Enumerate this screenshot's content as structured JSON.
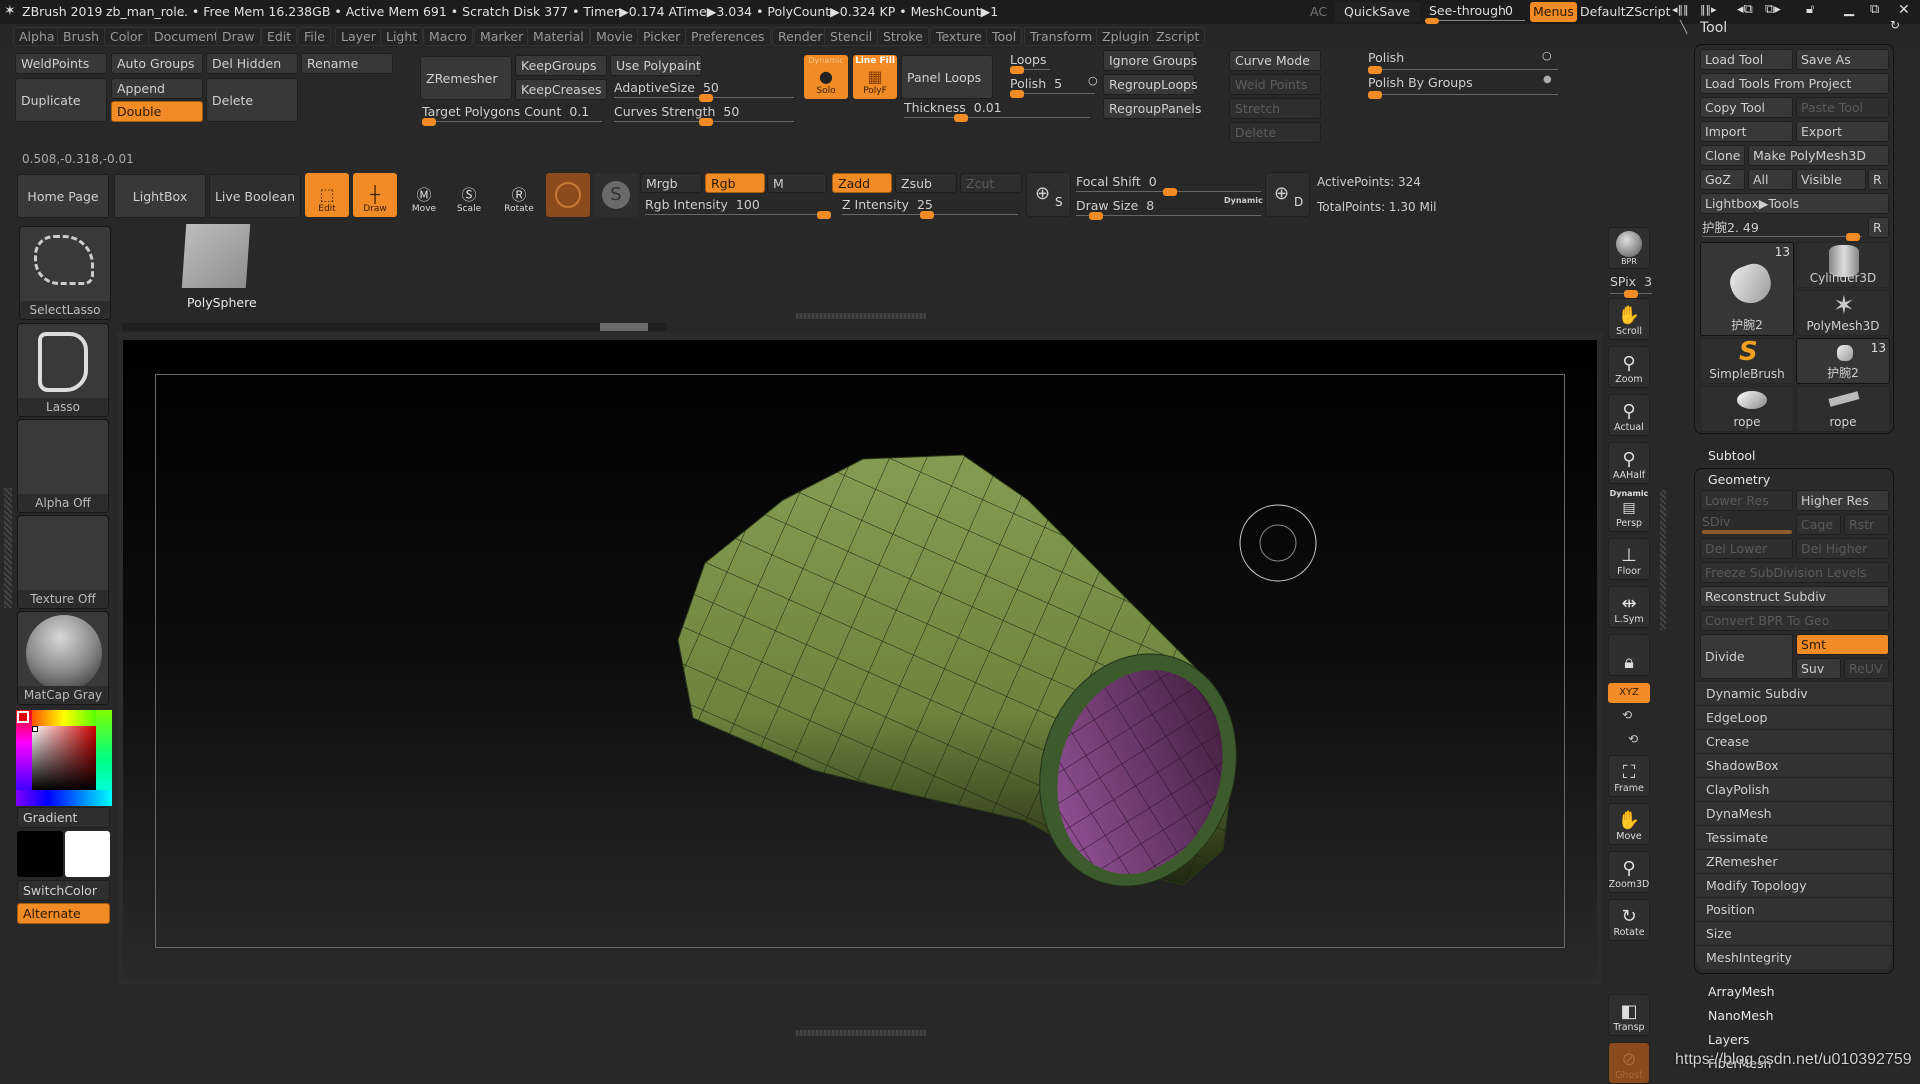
{
  "titlebar": {
    "app_title": "ZBrush 2019",
    "project": "zb_man_role",
    "status": ".. • Free Mem 16.238GB • Active Mem 691 • Scratch Disk 377 •  Timer▶0.174 ATime▶3.034 • PolyCount▶0.324 KP  • MeshCount▶1",
    "ac": "AC",
    "quicksave": "QuickSave",
    "see_through_label": "See-through",
    "see_through_value": "0",
    "see_through_fraction": 0.0,
    "menus": "Menus",
    "default_zscript": "DefaultZScript"
  },
  "menubar": [
    "Alpha",
    "Brush",
    "Color",
    "Document",
    "Draw",
    "Edit",
    "File",
    "Layer",
    "Light",
    "Macro",
    "Marker",
    "Material",
    "Movie",
    "Picker",
    "Preferences",
    "Render",
    "Stencil",
    "Stroke",
    "Texture",
    "Tool",
    "Transform",
    "Zplugin",
    "Zscript"
  ],
  "top_shelf": {
    "subtool_buttons": {
      "weldpoints": "WeldPoints",
      "auto_groups": "Auto Groups",
      "del_hidden": "Del Hidden",
      "rename": "Rename",
      "duplicate": "Duplicate",
      "append": "Append",
      "double": "Double",
      "delete": "Delete"
    },
    "zremesher": {
      "button": "ZRemesher",
      "keep_groups": "KeepGroups",
      "keep_creases": "KeepCreases",
      "use_polypaint": "Use Polypaint",
      "adaptive_size_label": "AdaptiveSize",
      "adaptive_size_value": "50",
      "target_polys_label": "Target Polygons Count",
      "target_polys_value": "0.1",
      "curves_strength_label": "Curves Strength",
      "curves_strength_value": "50"
    },
    "panel_loops": {
      "dynamic_label": "Dynamic",
      "solo_label": "Solo",
      "line_fill_label": "Line Fill",
      "polyf_label": "PolyF",
      "panel_loops_button": "Panel Loops",
      "thickness_label": "Thickness",
      "thickness_value": "0.01",
      "loops_label": "Loops",
      "polish_label": "Polish",
      "polish_value": "5",
      "ignore_groups": "Ignore Groups",
      "regroup_loops": "RegroupLoops",
      "regroup_panels": "RegroupPanels"
    },
    "curve": {
      "curve_mode": "Curve Mode",
      "weld_points": "Weld Points",
      "stretch": "Stretch",
      "delete": "Delete"
    },
    "polish": {
      "polish": "Polish",
      "polish_by_groups": "Polish By Groups"
    },
    "coordinates": "0.508,-0.318,-0.01"
  },
  "toolbar2": {
    "home_page": "Home Page",
    "lightbox": "LightBox",
    "live_boolean": "Live Boolean",
    "edit": "Edit",
    "draw": "Draw",
    "move": "Move",
    "scale": "Scale",
    "rotate": "Rotate",
    "mrgb": "Mrgb",
    "rgb": "Rgb",
    "m": "M",
    "zadd": "Zadd",
    "zsub": "Zsub",
    "zcut": "Zcut",
    "rgb_intensity_label": "Rgb Intensity",
    "rgb_intensity_value": "100",
    "z_intensity_label": "Z Intensity",
    "z_intensity_value": "25",
    "focal_shift_label": "Focal Shift",
    "focal_shift_value": "0",
    "draw_size_label": "Draw Size",
    "draw_size_value": "8",
    "dynamic_label": "Dynamic",
    "active_points": "ActivePoints: 324",
    "total_points": "TotalPoints: 1.30 Mil",
    "s_label": "S",
    "d_label": "D"
  },
  "left_shelf": {
    "select_lasso": "SelectLasso",
    "lasso": "Lasso",
    "alpha_off": "Alpha Off",
    "texture_off": "Texture Off",
    "matcap_gray": "MatCap Gray",
    "gradient": "Gradient",
    "switch_color": "SwitchColor",
    "alternate": "Alternate",
    "main_color": "#e00000",
    "secondary_color": "#ffffff"
  },
  "canvas": {
    "polysphere_label": "PolySphere",
    "mesh_outer_color": "#7a9448",
    "mesh_inner_color": "#8a4a88",
    "mesh_rim_color": "#3d5a2c"
  },
  "right_shelf": {
    "bpr": "BPR",
    "spix_label": "SPix",
    "spix_value": "3",
    "scroll": "Scroll",
    "zoom": "Zoom",
    "actual": "Actual",
    "aahalf": "AAHalf",
    "dynamic": "Dynamic",
    "persp": "Persp",
    "floor": "Floor",
    "lsym": "L.Sym",
    "xyz": "XYZ",
    "frame": "Frame",
    "move": "Move",
    "zoom3d": "Zoom3D",
    "rotate": "Rotate",
    "transp": "Transp",
    "ghost": "Ghost"
  },
  "tool_palette": {
    "title": "Tool",
    "load_tool": "Load Tool",
    "save_as": "Save As",
    "load_tools_from_project": "Load Tools From Project",
    "copy_tool": "Copy Tool",
    "paste_tool": "Paste Tool",
    "import": "Import",
    "export": "Export",
    "clone": "Clone",
    "make_polymesh3d": "Make PolyMesh3D",
    "goz": "GoZ",
    "all": "All",
    "visible": "Visible",
    "r": "R",
    "lightbox_tools": "Lightbox▶Tools",
    "current_tool_slider": "护腕2. 49",
    "tools": [
      {
        "name": "护腕2",
        "count": "13"
      },
      {
        "name": "Cylinder3D"
      },
      {
        "name": "PolyMesh3D"
      },
      {
        "name": "SimpleBrush"
      },
      {
        "name": "护腕2",
        "count": "13"
      },
      {
        "name": "rope"
      },
      {
        "name": "rope"
      }
    ],
    "subtool": "Subtool",
    "geometry": "Geometry",
    "lower_res": "Lower Res",
    "higher_res": "Higher Res",
    "sdiv": "SDiv",
    "cage": "Cage",
    "rstr": "Rstr",
    "del_lower": "Del Lower",
    "del_higher": "Del Higher",
    "freeze_subdiv": "Freeze SubDivision Levels",
    "reconstruct_subdiv": "Reconstruct Subdiv",
    "convert_bpr": "Convert BPR To Geo",
    "divide": "Divide",
    "smt": "Smt",
    "suv": "Suv",
    "reuv": "ReUV",
    "geometry_items": [
      "Dynamic Subdiv",
      "EdgeLoop",
      "Crease",
      "ShadowBox",
      "ClayPolish",
      "DynaMesh",
      "Tessimate",
      "ZRemesher",
      "Modify Topology",
      "Position",
      "Size",
      "MeshIntegrity"
    ],
    "sections": [
      "ArrayMesh",
      "NanoMesh",
      "Layers",
      "FiberMesh"
    ]
  },
  "watermark": "https://blog.csdn.net/u010392759"
}
